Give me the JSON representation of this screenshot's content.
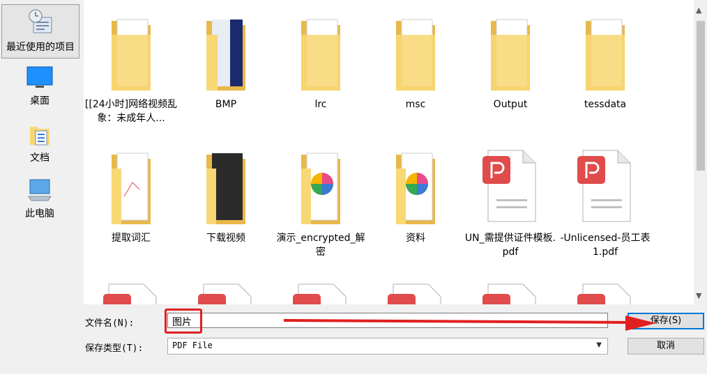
{
  "sidebar": {
    "items": [
      {
        "label": "最近使用的项目",
        "icon": "recent-items-icon"
      },
      {
        "label": "桌面",
        "icon": "desktop-icon"
      },
      {
        "label": "文档",
        "icon": "documents-icon"
      },
      {
        "label": "此电脑",
        "icon": "this-pc-icon"
      }
    ]
  },
  "files": [
    {
      "name": "[[24小时]网络视频乱象：未成年人...",
      "type": "folder"
    },
    {
      "name": "BMP",
      "type": "folder"
    },
    {
      "name": "lrc",
      "type": "folder"
    },
    {
      "name": "msc",
      "type": "folder"
    },
    {
      "name": "Output",
      "type": "folder"
    },
    {
      "name": "tessdata",
      "type": "folder"
    },
    {
      "name": "提取词汇",
      "type": "folder"
    },
    {
      "name": "下载视频",
      "type": "folder"
    },
    {
      "name": "演示_encrypted_解密",
      "type": "folder"
    },
    {
      "name": "资料",
      "type": "folder"
    },
    {
      "name": "UN_需提供证件模板.pdf",
      "type": "pdf"
    },
    {
      "name": "-Unlicensed-员工表1.pdf",
      "type": "pdf"
    }
  ],
  "form": {
    "filename_label": "文件名(N):",
    "filename_value": "图片",
    "filetype_label": "保存类型(T):",
    "filetype_value": "PDF File"
  },
  "buttons": {
    "save": "保存(S)",
    "cancel": "取消"
  },
  "colors": {
    "folder": "#f8d775",
    "pdf_red": "#e04b4b",
    "highlight": "#e02020",
    "accent": "#0078d7"
  }
}
